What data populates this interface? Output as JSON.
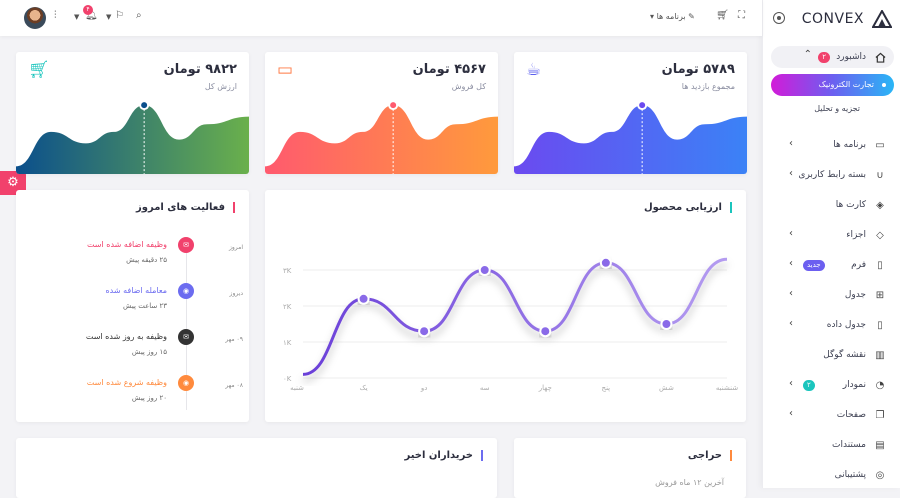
{
  "brand": {
    "name": "CONVEX"
  },
  "sidebar": {
    "dashboard": {
      "label": "داشبورد",
      "badge": "۲"
    },
    "sub_active": "تجارت الکترونیک",
    "sub_item": "تجزیه و تحلیل",
    "items": [
      {
        "label": "برنامه ها",
        "icon": "monitor-icon",
        "chev": true
      },
      {
        "label": "بسته رابط کاربری",
        "icon": "magnet-icon",
        "chev": true
      },
      {
        "label": "کارت ها",
        "icon": "layers-icon",
        "chev": false
      },
      {
        "label": "اجزاء",
        "icon": "package-icon",
        "chev": true
      },
      {
        "label": "فرم",
        "icon": "file-icon",
        "chev": true,
        "badge": "جدید",
        "badge_color": "#6c5ff0"
      },
      {
        "label": "جدول",
        "icon": "grid-icon",
        "chev": true
      },
      {
        "label": "جدول داده",
        "icon": "tablet-icon",
        "chev": true
      },
      {
        "label": "نقشه گوگل",
        "icon": "map-icon",
        "chev": false
      },
      {
        "label": "نمودار",
        "icon": "pie-icon",
        "chev": true,
        "badge": "۲",
        "badge_color": "#1bc5bd"
      },
      {
        "label": "صفحات",
        "icon": "pages-icon",
        "chev": true
      },
      {
        "label": "مستندات",
        "icon": "book-icon",
        "chev": false
      },
      {
        "label": "پشتیبانی",
        "icon": "lifebuoy-icon",
        "chev": false
      }
    ]
  },
  "topbar": {
    "apps_label": "برنامه ها",
    "notif_count": "۴"
  },
  "stats": [
    {
      "value": "۵۷۸۹ تومان",
      "label": "مجموع بازدید ها",
      "icon": "coffee-icon",
      "color": "#5b5fee"
    },
    {
      "value": "۴۵۶۷ تومان",
      "label": "کل فروش",
      "icon": "credit-card-icon",
      "color": "#ff7a45"
    },
    {
      "value": "۹۸۲۲ تومان",
      "label": "ارزش کل",
      "icon": "cart-icon",
      "color": "#1bc5bd"
    }
  ],
  "product_review": {
    "title": "ارزیابی محصول",
    "chart_data": {
      "type": "line",
      "categories": [
        "شنبه",
        "یک",
        "دو",
        "سه",
        "چهار",
        "پنج",
        "شش",
        "شنشنبه"
      ],
      "values": [
        0.1,
        2.2,
        1.3,
        3.0,
        1.3,
        3.2,
        1.5,
        3.3
      ],
      "ylim": [
        0,
        3.5
      ],
      "y_ticks": [
        "۰K",
        "۱K",
        "۲K",
        "۳K"
      ]
    }
  },
  "activity": {
    "title": "فعالیت های امروز",
    "items": [
      {
        "text": "وظیفه اضافه شده است",
        "time": "۲۵ دقیقه پیش",
        "date": "امروز",
        "color": "#f1416c",
        "icon": "mail-icon"
      },
      {
        "text": "معامله اضافه شده",
        "time": "۲۳ ساعت پیش",
        "date": "دیروز",
        "color": "#6c6cf0",
        "icon": "eye-icon"
      },
      {
        "text": "وظیفه به روز شده است",
        "time": "۱۵ روز پیش",
        "date": "۰۹ مهر",
        "color": "#333",
        "icon": "mail-icon"
      },
      {
        "text": "وظیفه شروع شده است",
        "time": "۲۰ روز پیش",
        "date": "۰۸ مهر",
        "color": "#ff8a3d",
        "icon": "eye-icon"
      }
    ]
  },
  "recent_buyers": {
    "title": "خریداران اخیر"
  },
  "auction": {
    "title": "حراجی",
    "subtitle": "آخرین ۱۲ ماه فروش"
  }
}
